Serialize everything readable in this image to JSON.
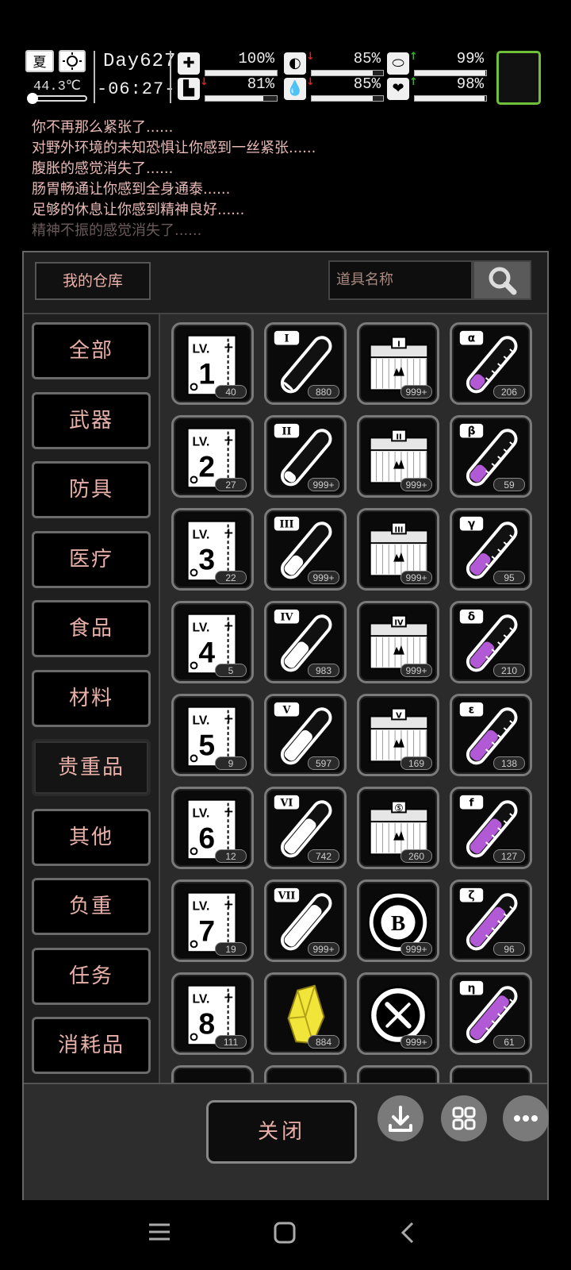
{
  "status": {
    "season": "夏",
    "temperature": "44.3℃",
    "day": "Day627",
    "time": "-06:27-",
    "stats": [
      {
        "icon": "medkit-icon",
        "pct": "100%",
        "value": 100,
        "arrow": "",
        "arrow_color": ""
      },
      {
        "icon": "stomach-icon",
        "pct": "85%",
        "value": 85,
        "arrow": "↓",
        "arrow_color": "#e02020"
      },
      {
        "icon": "bladder-icon",
        "pct": "99%",
        "value": 99,
        "arrow": "↑",
        "arrow_color": "#20c020"
      },
      {
        "icon": "boot-icon",
        "pct": "81%",
        "value": 81,
        "arrow": "↓",
        "arrow_color": "#e02020"
      },
      {
        "icon": "water-drop-icon",
        "pct": "85%",
        "value": 85,
        "arrow": "↓",
        "arrow_color": "#e02020"
      },
      {
        "icon": "heart-icon",
        "pct": "98%",
        "value": 98,
        "arrow": "↑",
        "arrow_color": "#20c020"
      }
    ]
  },
  "log": [
    "你不再那么紧张了......",
    "对野外环境的未知恐惧让你感到一丝紧张......",
    "腹胀的感觉消失了......",
    "肠胃畅通让你感到全身通泰......",
    "足够的休息让你感到精神良好......",
    "精神不振的感觉消失了......"
  ],
  "warehouse": {
    "title": "我的仓库",
    "search_placeholder": "道具名称",
    "categories": [
      "全部",
      "武器",
      "防具",
      "医疗",
      "食品",
      "材料",
      "贵重品",
      "其他",
      "负重",
      "任务",
      "消耗品"
    ],
    "selected_category": "贵重品",
    "items": [
      {
        "kind": "book",
        "label": "1",
        "count": "40"
      },
      {
        "kind": "tube",
        "label": "I",
        "count": "880",
        "fill": 0.05,
        "color": "#ffffff"
      },
      {
        "kind": "chest",
        "label": "I",
        "count": "999+"
      },
      {
        "kind": "flask",
        "label": "α",
        "count": "206",
        "fill": 0.25,
        "color": "#b25ad6"
      },
      {
        "kind": "book",
        "label": "2",
        "count": "27"
      },
      {
        "kind": "tube",
        "label": "II",
        "count": "999+",
        "fill": 0.15,
        "color": "#ffffff"
      },
      {
        "kind": "chest",
        "label": "II",
        "count": "999+"
      },
      {
        "kind": "flask",
        "label": "β",
        "count": "59",
        "fill": 0.3,
        "color": "#b25ad6"
      },
      {
        "kind": "book",
        "label": "3",
        "count": "22"
      },
      {
        "kind": "tube",
        "label": "III",
        "count": "999+",
        "fill": 0.35,
        "color": "#ffffff"
      },
      {
        "kind": "chest",
        "label": "III",
        "count": "999+"
      },
      {
        "kind": "flask",
        "label": "γ",
        "count": "95",
        "fill": 0.4,
        "color": "#b25ad6"
      },
      {
        "kind": "book",
        "label": "4",
        "count": "5"
      },
      {
        "kind": "tube",
        "label": "IV",
        "count": "983",
        "fill": 0.5,
        "color": "#ffffff"
      },
      {
        "kind": "chest",
        "label": "IV",
        "count": "999+"
      },
      {
        "kind": "flask",
        "label": "δ",
        "count": "210",
        "fill": 0.5,
        "color": "#b25ad6"
      },
      {
        "kind": "book",
        "label": "5",
        "count": "9"
      },
      {
        "kind": "tube",
        "label": "V",
        "count": "597",
        "fill": 0.6,
        "color": "#ffffff"
      },
      {
        "kind": "chest",
        "label": "V",
        "count": "169"
      },
      {
        "kind": "flask",
        "label": "ε",
        "count": "138",
        "fill": 0.6,
        "color": "#b25ad6"
      },
      {
        "kind": "book",
        "label": "6",
        "count": "12"
      },
      {
        "kind": "tube",
        "label": "VI",
        "count": "742",
        "fill": 0.7,
        "color": "#ffffff"
      },
      {
        "kind": "chest",
        "label": "Ⓢ",
        "count": "260"
      },
      {
        "kind": "flask",
        "label": "f",
        "count": "127",
        "fill": 0.7,
        "color": "#b25ad6"
      },
      {
        "kind": "book",
        "label": "7",
        "count": "19"
      },
      {
        "kind": "tube",
        "label": "VII",
        "count": "999+",
        "fill": 0.85,
        "color": "#ffffff"
      },
      {
        "kind": "coin",
        "label": "B",
        "count": "999+"
      },
      {
        "kind": "flask",
        "label": "ζ",
        "count": "96",
        "fill": 0.8,
        "color": "#b25ad6"
      },
      {
        "kind": "book",
        "label": "8",
        "count": "111"
      },
      {
        "kind": "crystal",
        "label": "",
        "count": "884"
      },
      {
        "kind": "tool-coin",
        "label": "",
        "count": "999+"
      },
      {
        "kind": "flask",
        "label": "η",
        "count": "61",
        "fill": 0.9,
        "color": "#b25ad6"
      }
    ],
    "close_label": "关闭"
  }
}
